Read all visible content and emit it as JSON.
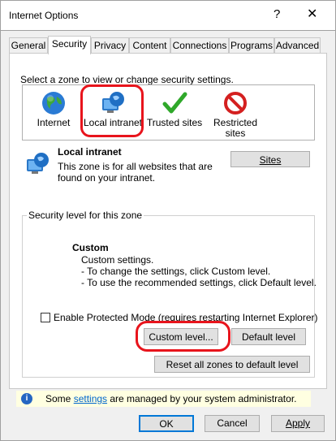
{
  "window": {
    "title": "Internet Options",
    "help": "?",
    "close": "✕"
  },
  "tabs": [
    "General",
    "Security",
    "Privacy",
    "Content",
    "Connections",
    "Programs",
    "Advanced"
  ],
  "active_tab": "Security",
  "zones": {
    "prompt": "Select a zone to view or change security settings.",
    "items": [
      {
        "label": "Internet",
        "icon": "globe-icon"
      },
      {
        "label": "Local intranet",
        "icon": "intranet-icon"
      },
      {
        "label": "Trusted sites",
        "icon": "checkmark-icon"
      },
      {
        "label": "Restricted sites",
        "icon": "restricted-icon"
      }
    ]
  },
  "selected_zone": {
    "name": "Local intranet",
    "description": "This zone is for all websites that are found on your intranet.",
    "sites_button": "Sites"
  },
  "security_level": {
    "group_label": "Security level for this zone",
    "level_name": "Custom",
    "lines": [
      "Custom settings.",
      "- To change the settings, click Custom level.",
      "- To use the recommended settings, click Default level."
    ],
    "protected_mode_label": "Enable Protected Mode (requires restarting Internet Explorer)",
    "protected_mode_checked": false,
    "custom_level_button": "Custom level...",
    "default_level_button": "Default level",
    "reset_all_button": "Reset all zones to default level"
  },
  "info": {
    "prefix": "Some ",
    "link": "settings",
    "suffix": " are managed by your system administrator."
  },
  "footer": {
    "ok": "OK",
    "cancel": "Cancel",
    "apply": "Apply"
  },
  "colors": {
    "highlight_circle": "#e8141c",
    "link": "#0066cc",
    "info_bg": "#ffffe1"
  }
}
